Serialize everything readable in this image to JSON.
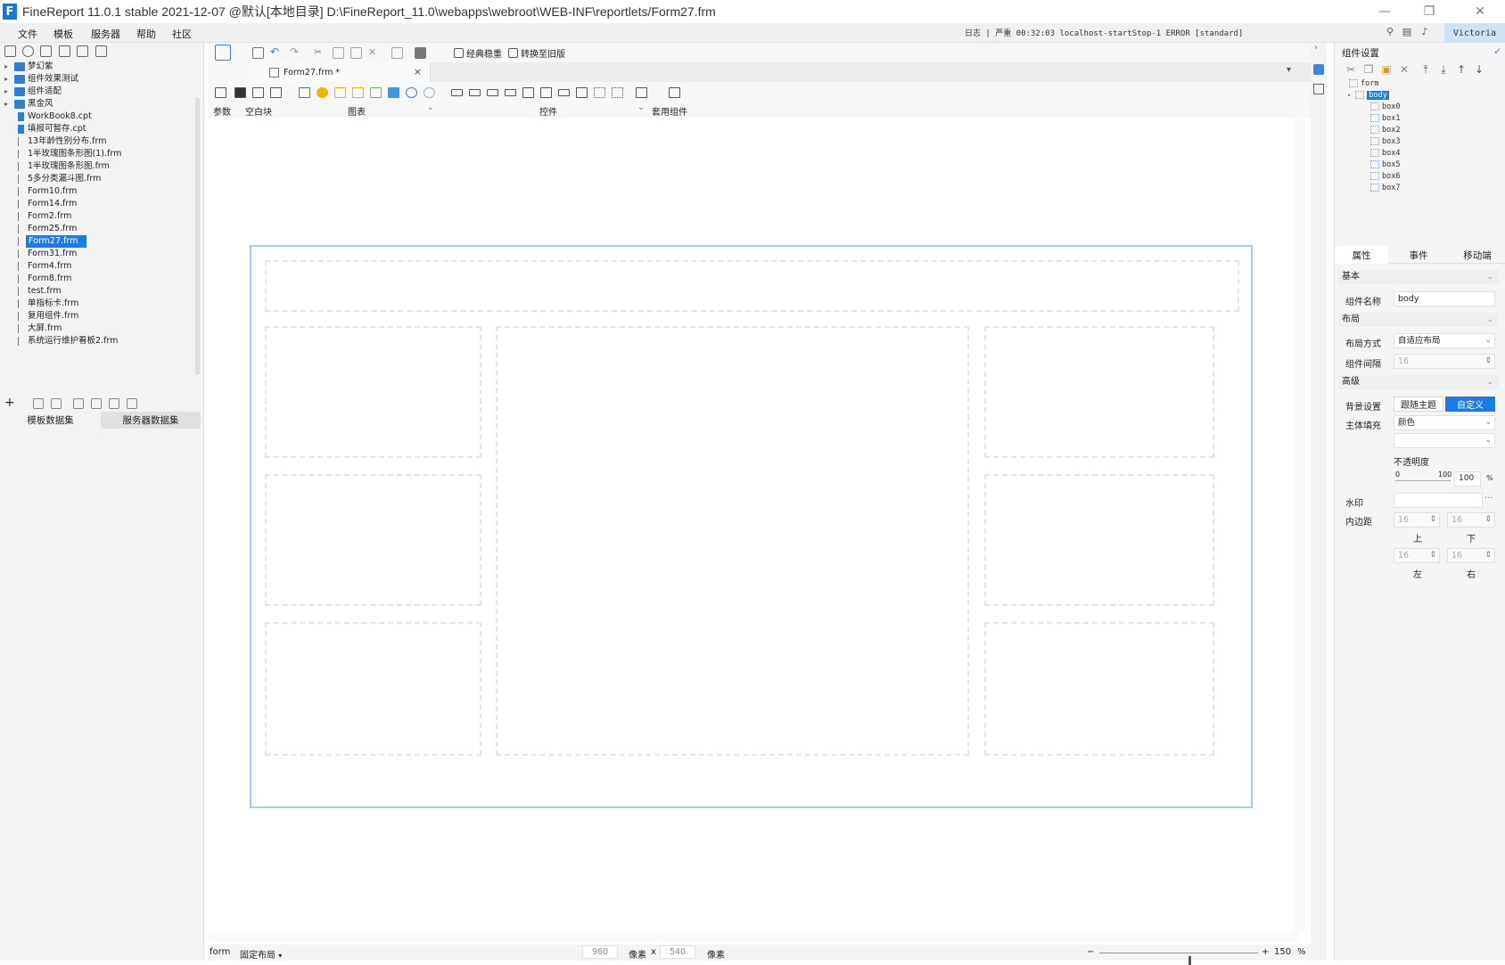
{
  "window": {
    "title": "FineReport 11.0.1 stable 2021-12-07 @默认[本地目录]    D:\\FineReport_11.0\\webapps\\webroot\\WEB-INF\\reportlets/Form27.frm",
    "logo": "F"
  },
  "menu": {
    "items": [
      "文件",
      "模板",
      "服务器",
      "帮助",
      "社区"
    ],
    "log_text": "日志 | 严重 00:32:03 localhost-startStop-1 ERROR [standard]",
    "user": "Victoria"
  },
  "left_panel": {
    "tree": [
      {
        "label": "梦幻紫",
        "type": "folder"
      },
      {
        "label": "组件效果测试",
        "type": "folder"
      },
      {
        "label": "组件适配",
        "type": "folder"
      },
      {
        "label": "黑金风",
        "type": "folder"
      },
      {
        "label": "WorkBook8.cpt",
        "type": "cpt"
      },
      {
        "label": "填报可暂存.cpt",
        "type": "cpt"
      },
      {
        "label": "13年龄性别分布.frm",
        "type": "frm"
      },
      {
        "label": "1半玫瑰图条形图(1).frm",
        "type": "frm"
      },
      {
        "label": "1半玫瑰图条形图.frm",
        "type": "frm"
      },
      {
        "label": "5多分类漏斗图.frm",
        "type": "frm"
      },
      {
        "label": "Form10.frm",
        "type": "frm"
      },
      {
        "label": "Form14.frm",
        "type": "frm"
      },
      {
        "label": "Form2.frm",
        "type": "frm"
      },
      {
        "label": "Form25.frm",
        "type": "frm"
      },
      {
        "label": "Form27.frm",
        "type": "frm",
        "selected": true
      },
      {
        "label": "Form31.frm",
        "type": "frm"
      },
      {
        "label": "Form4.frm",
        "type": "frm"
      },
      {
        "label": "Form8.frm",
        "type": "frm"
      },
      {
        "label": "test.frm",
        "type": "frm"
      },
      {
        "label": "单指标卡.frm",
        "type": "frm"
      },
      {
        "label": "复用组件.frm",
        "type": "frm"
      },
      {
        "label": "大屏.frm",
        "type": "frm"
      },
      {
        "label": "系统运行维护看板2.frm",
        "type": "frm"
      }
    ],
    "dataset_tabs": [
      "模板数据集",
      "服务器数据集"
    ]
  },
  "toolbar": {
    "classic_label": "经典稳重",
    "switch_label": "转换至旧版"
  },
  "tabs": {
    "file_tab": "Form27.frm *",
    "close": "×"
  },
  "components": {
    "param_label": "参数",
    "blank_label": "空白块",
    "chart_label": "图表",
    "widget_label": "控件",
    "set_label": "套用组件"
  },
  "status": {
    "mode": "form",
    "layout": "固定布局",
    "width": "960",
    "unit1": "像素",
    "x": "x",
    "height": "540",
    "unit2": "像素",
    "zoom_minus": "−",
    "zoom_plus": "+",
    "zoom_value": "150",
    "zoom_unit": "%",
    "zoom_fraction": 0.56
  },
  "right_panel": {
    "title": "组件设置",
    "tree_root": "form",
    "tree_body": "body",
    "tree_items": [
      "box0",
      "box1",
      "box2",
      "box3",
      "box4",
      "box5",
      "box6",
      "box7"
    ],
    "tabs": [
      "属性",
      "事件",
      "移动端"
    ],
    "sections": {
      "basic": "基本",
      "layout": "布局",
      "advanced": "高级"
    },
    "labels": {
      "name": "组件名称",
      "layout_mode": "布局方式",
      "gap": "组件间隔",
      "background": "背景设置",
      "fill": "主体填充",
      "opacity": "不透明度",
      "watermark": "水印",
      "padding": "内边距"
    },
    "values": {
      "name": "body",
      "layout_mode": "自适应布局",
      "gap": "16",
      "bg_follow": "跟随主题",
      "bg_custom": "自定义",
      "fill": "颜色",
      "opacity_min": "0",
      "opacity_max": "100",
      "opacity": "100",
      "opacity_unit": "%",
      "watermark_more": "···",
      "pad_top": "16",
      "pad_bottom": "16",
      "pad_left": "16",
      "pad_right": "16",
      "lbl_top": "上",
      "lbl_bottom": "下",
      "lbl_left": "左",
      "lbl_right": "右"
    }
  },
  "colors": {
    "accent": "#1c7ce6",
    "canvas_border": "#a9c9ee",
    "dashed": "#e4e4e4"
  }
}
